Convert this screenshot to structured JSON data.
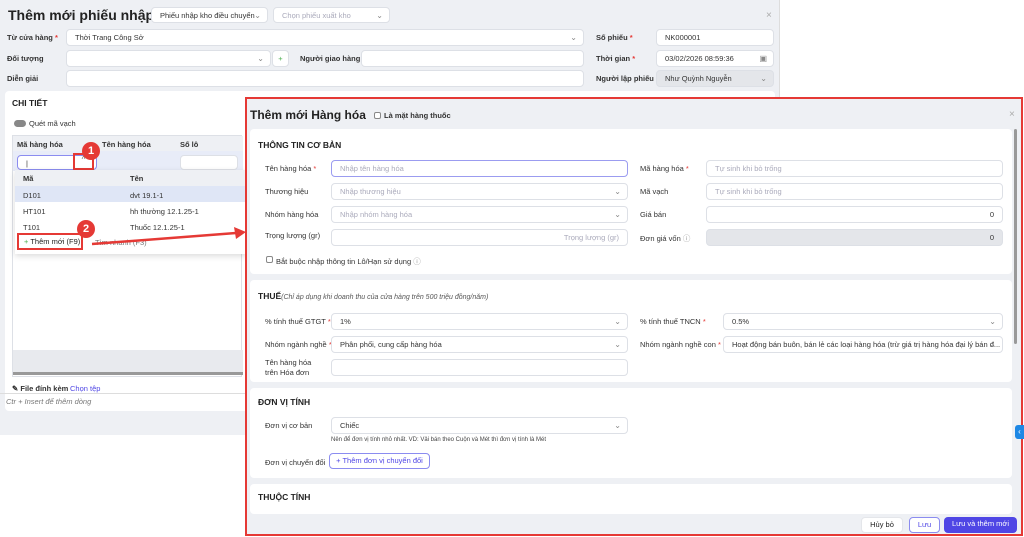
{
  "main": {
    "title": "Thêm mới phiếu nhập kho",
    "voucher_type": "Phiếu nhập kho điều chuyển",
    "export_voucher_placeholder": "Chọn phiếu xuất kho",
    "from_store_label": "Từ cửa hàng",
    "from_store_value": "Thời Trang Công Sở",
    "object_label": "Đối tượng",
    "deliverer_label": "Người giao hàng",
    "description_label": "Diễn giải",
    "voucher_no_label": "Số phiếu",
    "voucher_no_value": "NK000001",
    "time_label": "Thời gian",
    "time_value": "03/02/2026 08:59:36",
    "creator_label": "Người lập phiếu",
    "creator_value": "Như Quỳnh Nguyễn",
    "detail_title": "CHI TIẾT",
    "scan_label": "Quét mã vạch",
    "columns": [
      "Mã hàng hóa",
      "Tên hàng hóa",
      "Số lô"
    ],
    "dropdown": {
      "headers": [
        "Mã",
        "Tên"
      ],
      "rows": [
        {
          "code": "D101",
          "name": "dvt 19.1-1"
        },
        {
          "code": "HT101",
          "name": "hh thường 12.1.25-1"
        },
        {
          "code": "T101",
          "name": "Thuốc 12.1.25-1"
        }
      ],
      "add_new": "Thêm mới (F9)",
      "quick_search": "Tìm nhanh (F3)"
    },
    "attach_label": "File đính kèm",
    "choose_file": "Chọn tệp",
    "hint": "Ctr + Insert để thêm dòng",
    "badges": [
      "1",
      "2"
    ]
  },
  "modal": {
    "title": "Thêm mới Hàng hóa",
    "medicine_label": "Là mặt hàng thuốc",
    "basic_title": "THÔNG TIN CƠ BẢN",
    "name_label": "Tên hàng hóa",
    "name_ph": "Nhập tên hàng hóa",
    "brand_label": "Thương hiệu",
    "brand_ph": "Nhập thương hiệu",
    "group_label": "Nhóm hàng hóa",
    "group_ph": "Nhập nhóm hàng hóa",
    "weight_label": "Trọng lượng (gr)",
    "weight_ph": "Trọng lượng (gr)",
    "code_label": "Mã hàng hóa",
    "code_ph": "Tự sinh khi bỏ trống",
    "barcode_label": "Mã vạch",
    "barcode_ph": "Tự sinh khi bỏ trống",
    "price_label": "Giá bán",
    "price_value": "0",
    "cost_label": "Đơn giá vốn",
    "cost_value": "0",
    "lot_label": "Bắt buộc nhập thông tin Lô/Hạn sử dụng",
    "tax_title": "THUẾ",
    "tax_note": "(Chỉ áp dụng khi doanh thu của cửa hàng trên 500 triệu đồng/năm)",
    "vat_label": "% tính thuế GTGT",
    "vat_value": "1%",
    "pit_label": "% tính thuế TNCN",
    "pit_value": "0.5%",
    "industry_label": "Nhóm ngành nghề",
    "industry_value": "Phân phối, cung cấp hàng hóa",
    "subindustry_label": "Nhóm ngành nghề con",
    "subindustry_value": "Hoạt động bán buôn, bán lẻ các loại hàng hóa (trừ giá trị hàng hóa đại lý bán đ...",
    "invoice_name_label": "Tên hàng hóa trên Hóa đơn",
    "unit_title": "ĐƠN VỊ TÍNH",
    "base_unit_label": "Đơn vị cơ bản",
    "base_unit_value": "Chiếc",
    "unit_hint": "Nên để đơn vị tính nhỏ nhất. VD: Vải bán theo Cuộn và Mét thì đơn vị tính là Mét",
    "convert_label": "Đơn vị chuyển đổi",
    "convert_button": "Thêm đơn vị chuyển đổi",
    "attr_title": "THUỘC TÍNH",
    "cancel": "Hủy bỏ",
    "save": "Lưu",
    "save_new": "Lưu và thêm mới"
  },
  "colors": {
    "accent": "#4f46e5",
    "annotation": "#e53935"
  }
}
